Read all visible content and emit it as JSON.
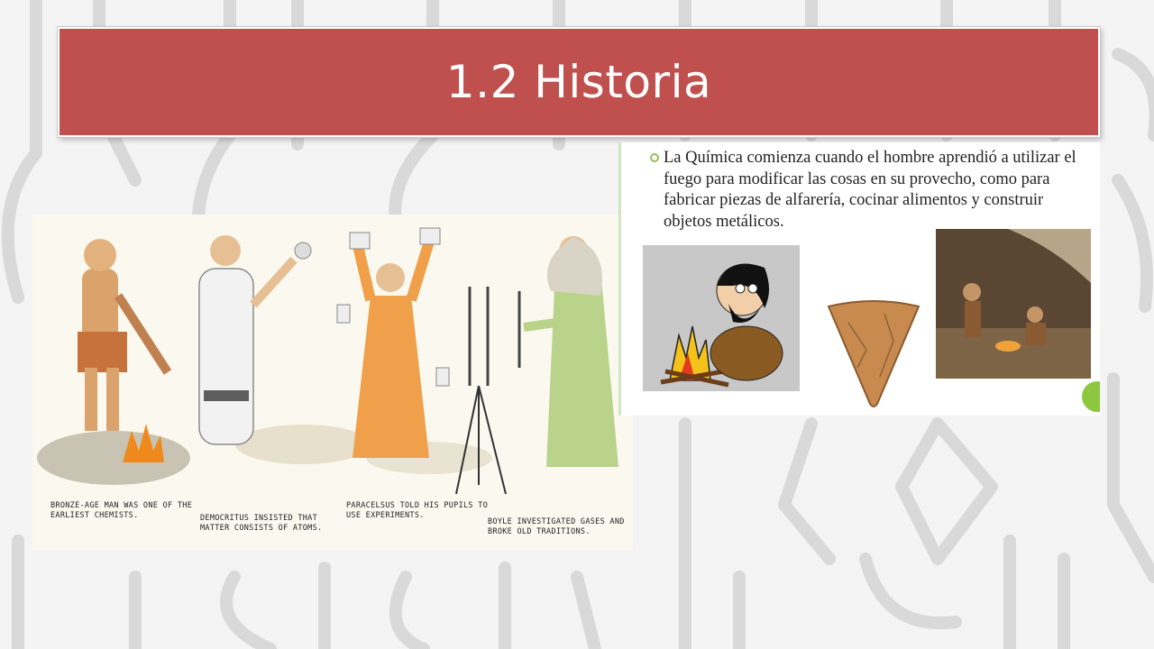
{
  "slide": {
    "title": "1.2 Historia"
  },
  "left_image": {
    "captions": [
      "Bronze-age man was one of the earliest chemists.",
      "Democritus insisted that matter consists of atoms.",
      "Paracelsus told his pupils to use experiments.",
      "Boyle investigated gases and broke old traditions."
    ]
  },
  "right_image": {
    "bullet": "La Química comienza cuando el hombre aprendió a utilizar el fuego para modificar las cosas en su provecho, como para fabricar piezas de alfarería, cocinar alimentos y construir objetos metálicos."
  },
  "colors": {
    "title_bar": "#c0504d",
    "bullet_accent": "#9bbb59"
  },
  "icons": [
    "flask-outline-pattern",
    "fire-icon",
    "bullet-ring-icon"
  ]
}
